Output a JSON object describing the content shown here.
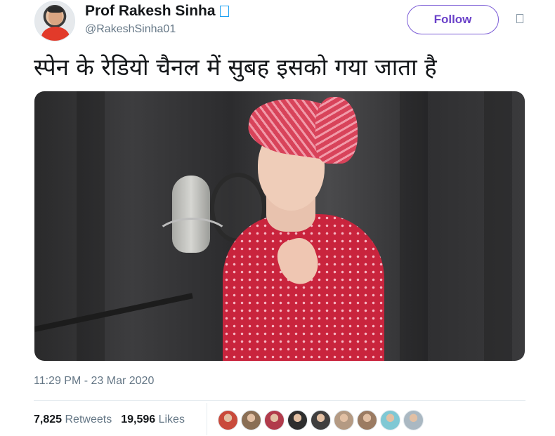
{
  "author": {
    "name": "Prof Rakesh Sinha",
    "handle": "@RakeshSinha01",
    "verified": true
  },
  "actions": {
    "follow_label": "Follow",
    "more_icon": "chevron-down-icon"
  },
  "tweet": {
    "text": "स्पेन के रेडियो चैनल में सुबह इसको गया जाता है",
    "timestamp": "11:29 PM - 23 Mar 2020",
    "media": "video-thumbnail"
  },
  "stats": {
    "retweets_count": "7,825",
    "retweets_label": "Retweets",
    "likes_count": "19,596",
    "likes_label": "Likes"
  },
  "likers": [
    {
      "color": "#c94a3b"
    },
    {
      "color": "#8a6f55"
    },
    {
      "color": "#b13b4b"
    },
    {
      "color": "#2e2e2e"
    },
    {
      "color": "#3f3f3f"
    },
    {
      "color": "#b49a83"
    },
    {
      "color": "#9b7b62"
    },
    {
      "color": "#7fc8d4"
    },
    {
      "color": "#aab8c2"
    }
  ],
  "colors": {
    "accent": "#6a41c9",
    "secondary_text": "#657786",
    "primary_text": "#14171a"
  }
}
